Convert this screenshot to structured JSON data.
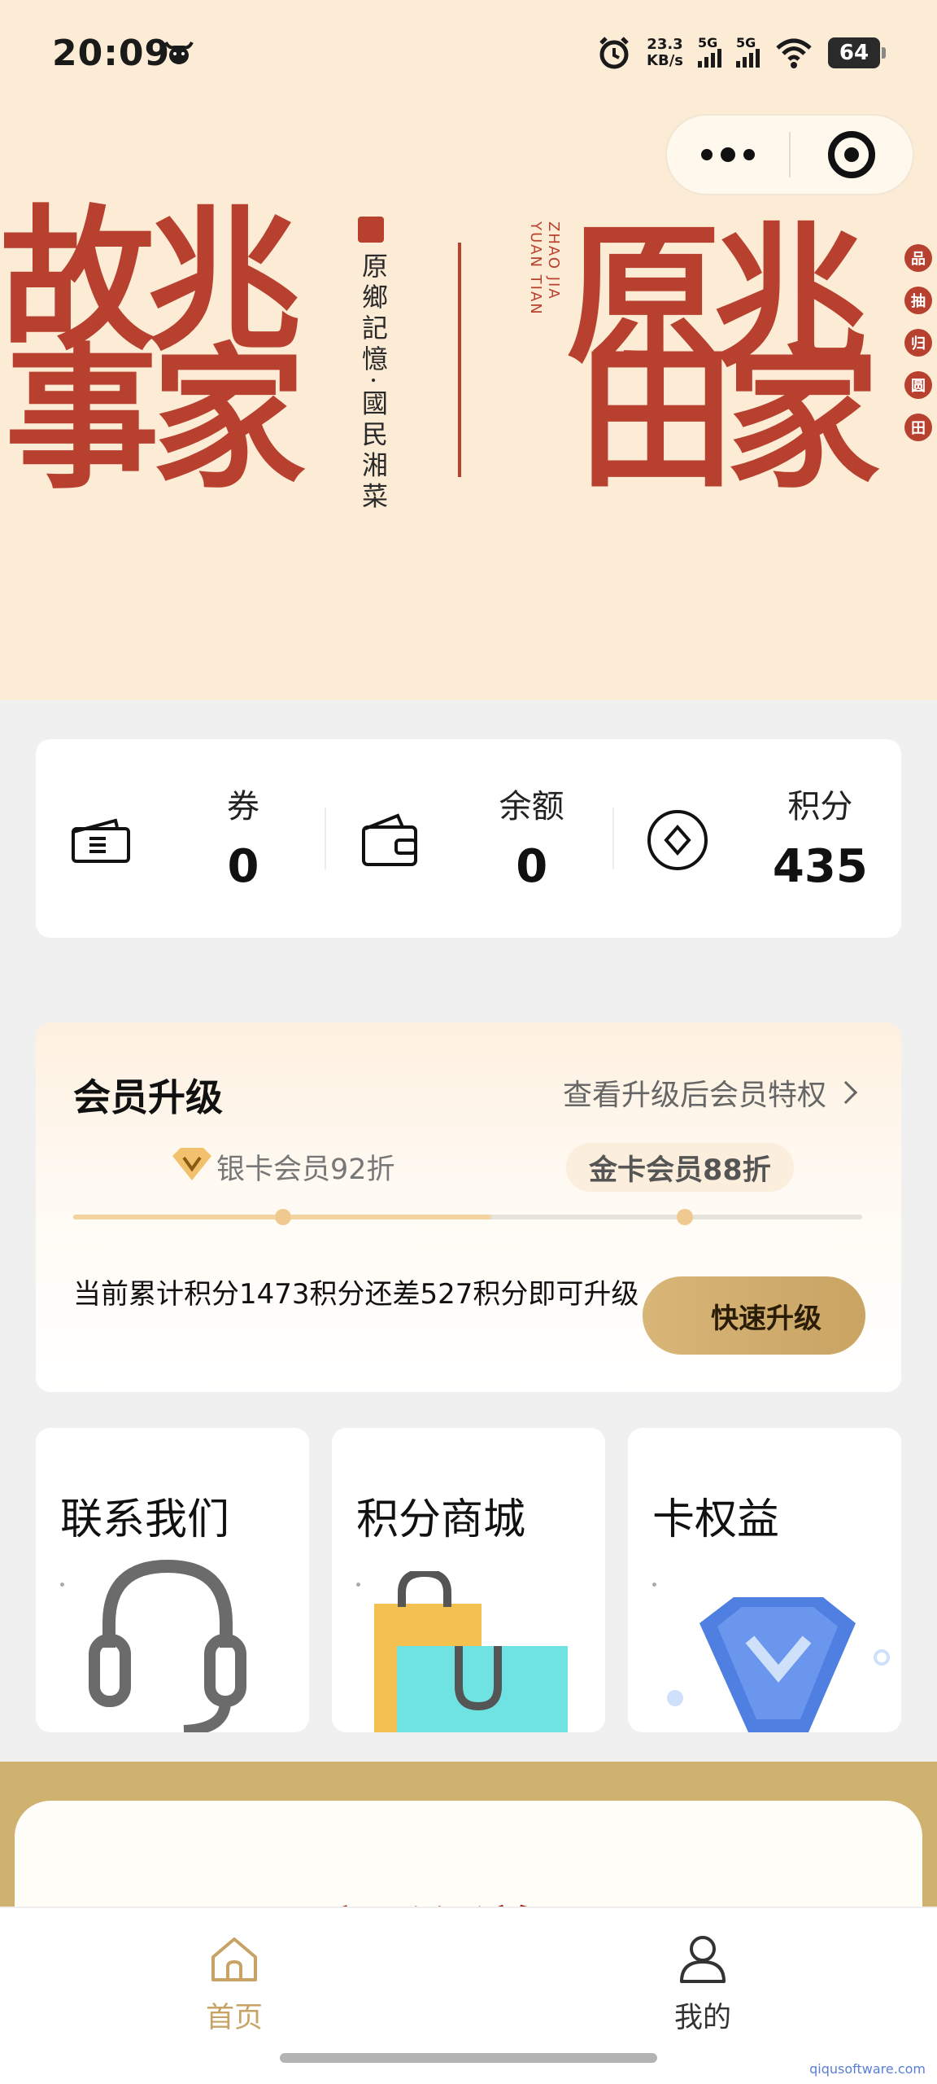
{
  "status_bar": {
    "time": "20:09",
    "net_speed_value": "23.3",
    "net_speed_unit": "KB/s",
    "signal_1": "5G",
    "signal_2": "5G",
    "battery": "64"
  },
  "banner": {
    "left_line_1": "故兆",
    "left_line_2": "事家",
    "subtitle_vertical": "原鄉記憶·國民湘菜",
    "english_vertical_1": "YUAN TIAN",
    "english_vertical_2": "ZHAO JIA",
    "right_line_1": "原兆",
    "right_line_2": "田家",
    "side_tags": [
      "品",
      "抽",
      "归",
      "圆",
      "田"
    ],
    "accent_color": "#b8402e"
  },
  "assets": {
    "items": [
      {
        "label": "券",
        "value": "0",
        "icon": "ticket-icon"
      },
      {
        "label": "余额",
        "value": "0",
        "icon": "wallet-icon"
      },
      {
        "label": "积分",
        "value": "435",
        "icon": "coin-icon"
      }
    ]
  },
  "upgrade": {
    "title": "会员升级",
    "link": "查看升级后会员特权",
    "current_tier": "银卡会员92折",
    "next_tier": "金卡会员88折",
    "progress": 0.53,
    "description": "当前累计积分1473积分还差527积分即可升级",
    "button": "快速升级"
  },
  "tiles": [
    {
      "title": "联系我们",
      "icon": "headset-icon"
    },
    {
      "title": "积分商城",
      "icon": "shopping-bag-icon"
    },
    {
      "title": "卡权益",
      "icon": "diamond-icon"
    }
  ],
  "points_section": {
    "title": "积分说明"
  },
  "tabbar": {
    "home": "首页",
    "mine": "我的",
    "active_color": "#c7a465"
  },
  "watermark": "qiqusoftware.com"
}
